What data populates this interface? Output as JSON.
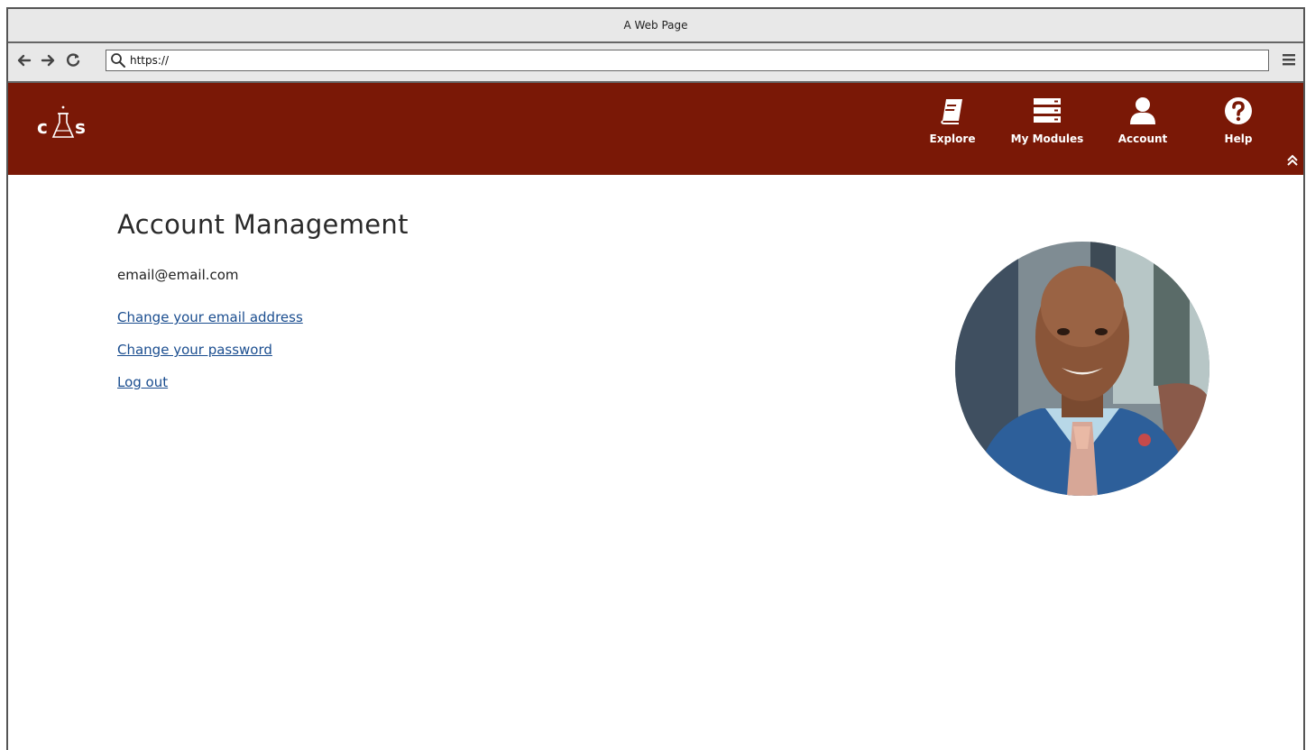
{
  "browser": {
    "window_title": "A Web Page",
    "url": "https://"
  },
  "header": {
    "logo_alt": "CAS logo",
    "nav": [
      {
        "label": "Explore",
        "icon": "book-icon"
      },
      {
        "label": "My Modules",
        "icon": "list-icon"
      },
      {
        "label": "Account",
        "icon": "user-icon"
      },
      {
        "label": "Help",
        "icon": "question-icon"
      }
    ],
    "background": "#7a1806"
  },
  "main": {
    "title": "Account Management",
    "email": "email@email.com",
    "links": [
      {
        "label": "Change your email address"
      },
      {
        "label": "Change your password"
      },
      {
        "label": "Log out"
      }
    ],
    "avatar_icon": "profile-photo"
  }
}
